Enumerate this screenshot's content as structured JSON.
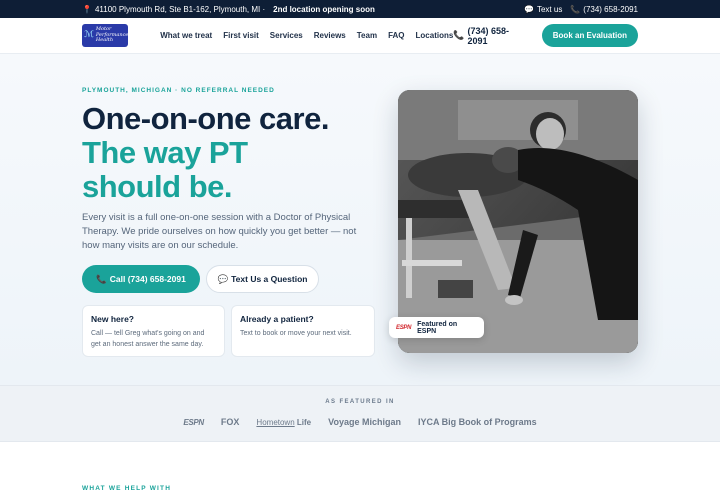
{
  "topbar": {
    "address": "41100 Plymouth Rd, Ste B1-162, Plymouth, MI ·",
    "second_location": "2nd location opening soon",
    "text_us": "Text us",
    "phone": "(734) 658-2091"
  },
  "header": {
    "logo_text": "Motor Performance Health",
    "nav": [
      "What we treat",
      "First visit",
      "Services",
      "Reviews",
      "Team",
      "FAQ",
      "Locations"
    ],
    "phone": "(734) 658-2091",
    "cta_label": "Book an Evaluation"
  },
  "hero": {
    "eyebrow": "PLYMOUTH, MICHIGAN · NO REFERRAL NEEDED",
    "headline_line1": "One-on-one care.",
    "headline_line2": "The way PT should be.",
    "lead": "Every visit is a full one-on-one session with a Doctor of Physical Therapy. We pride ourselves on how quickly you get better — not how many visits are on our schedule.",
    "call_button": "Call (734) 658-2091",
    "text_button": "Text Us a Question",
    "cards": [
      {
        "title": "New here?",
        "body": "Call — tell Greg what's going on and get an honest answer the same day."
      },
      {
        "title": "Already a patient?",
        "body": "Text to book or move your next visit."
      }
    ],
    "badge": {
      "logo": "ESPN",
      "label": "Featured on ESPN"
    }
  },
  "featured": {
    "label": "AS FEATURED IN",
    "logos": [
      "ESPN",
      "FOX",
      "Hometown",
      "Life",
      "Voyage Michigan",
      "IYCA Big Book of Programs"
    ]
  },
  "help": {
    "label": "WHAT WE HELP WITH"
  },
  "colors": {
    "navy": "#0e1e36",
    "teal": "#1aa39a",
    "logo_blue": "#2a3aa8"
  },
  "icons": [
    "map-pin-icon",
    "chat-icon",
    "phone-icon"
  ]
}
